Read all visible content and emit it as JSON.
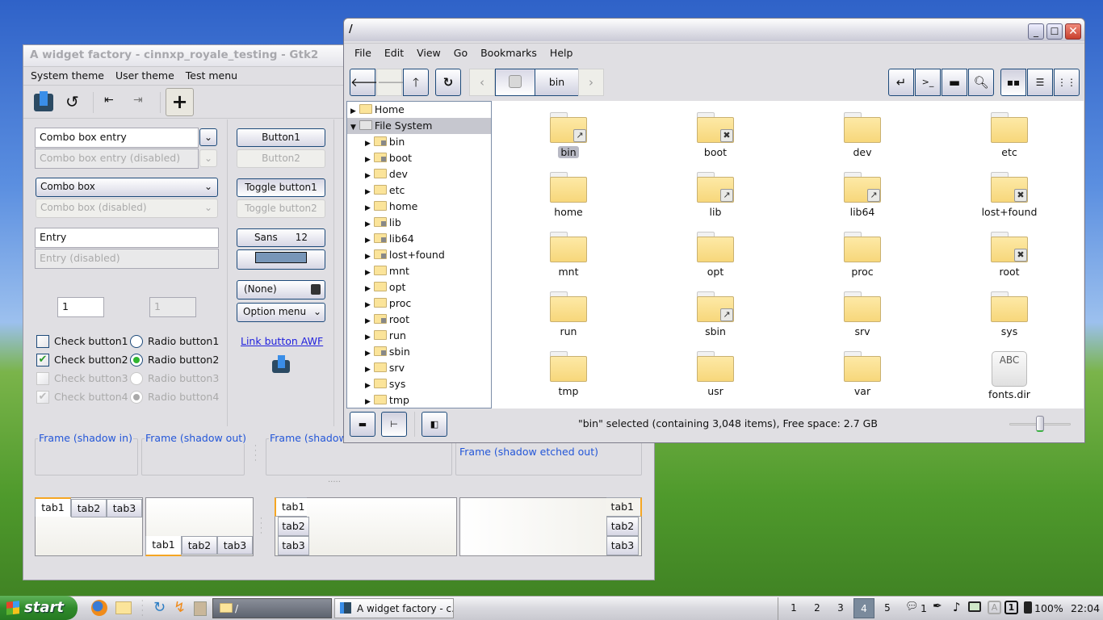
{
  "widget_factory": {
    "title": "A widget factory - cinnxp_royale_testing - Gtk2",
    "menu": [
      "System theme",
      "User theme",
      "Test menu"
    ],
    "toolbar_icons": [
      "awf-logo-icon",
      "refresh-icon",
      "previous-icon",
      "next-icon",
      "add-icon"
    ],
    "combo_entry": "Combo box entry",
    "combo_entry_disabled": "Combo box entry (disabled)",
    "combo": "Combo box",
    "combo_disabled": "Combo box (disabled)",
    "entry": "Entry",
    "entry_disabled": "Entry (disabled)",
    "spin1": "1",
    "spin2": "1",
    "checks": [
      {
        "label": "Check button1",
        "checked": false
      },
      {
        "label": "Check button2",
        "checked": true
      },
      {
        "label": "Check button3",
        "checked": false
      },
      {
        "label": "Check button4",
        "checked": true
      }
    ],
    "radios": [
      {
        "label": "Radio button1",
        "selected": false
      },
      {
        "label": "Radio button2",
        "selected": true
      },
      {
        "label": "Radio button3",
        "selected": false
      },
      {
        "label": "Radio button4",
        "selected": true
      }
    ],
    "button1": "Button1",
    "button2": "Button2",
    "toggle1": "Toggle button1",
    "toggle2": "Toggle button2",
    "font_name": "Sans",
    "font_size": "12",
    "color_value": "#7896b8",
    "file_chooser": "(None)",
    "option_menu": "Option menu",
    "link": "Link button AWF",
    "frames": [
      "Frame (shadow in)",
      "Frame (shadow out)",
      "Frame (shadow etched in)",
      "Frame (shadow etched out)"
    ],
    "tabs": [
      "tab1",
      "tab2",
      "tab3"
    ]
  },
  "file_manager": {
    "title": "/",
    "menu": [
      "File",
      "Edit",
      "View",
      "Go",
      "Bookmarks",
      "Help"
    ],
    "path_current": "bin",
    "tree": [
      {
        "label": "Home",
        "expanded": false
      },
      {
        "label": "File System",
        "expanded": true,
        "selected": true
      }
    ],
    "tree_children": [
      {
        "n": "bin",
        "e": "link"
      },
      {
        "n": "boot",
        "e": "x"
      },
      {
        "n": "dev"
      },
      {
        "n": "etc"
      },
      {
        "n": "home"
      },
      {
        "n": "lib",
        "e": "link"
      },
      {
        "n": "lib64",
        "e": "link"
      },
      {
        "n": "lost+found",
        "e": "x"
      },
      {
        "n": "mnt"
      },
      {
        "n": "opt"
      },
      {
        "n": "proc"
      },
      {
        "n": "root",
        "e": "x"
      },
      {
        "n": "run"
      },
      {
        "n": "sbin",
        "e": "link"
      },
      {
        "n": "srv"
      },
      {
        "n": "sys"
      },
      {
        "n": "tmp"
      }
    ],
    "files": [
      {
        "n": "bin",
        "e": "link",
        "selected": true
      },
      {
        "n": "boot",
        "e": "x"
      },
      {
        "n": "dev"
      },
      {
        "n": "etc"
      },
      {
        "n": "home"
      },
      {
        "n": "lib",
        "e": "link"
      },
      {
        "n": "lib64",
        "e": "link"
      },
      {
        "n": "lost+found",
        "e": "x"
      },
      {
        "n": "mnt"
      },
      {
        "n": "opt"
      },
      {
        "n": "proc"
      },
      {
        "n": "root",
        "e": "x"
      },
      {
        "n": "run"
      },
      {
        "n": "sbin",
        "e": "link"
      },
      {
        "n": "srv"
      },
      {
        "n": "sys"
      },
      {
        "n": "tmp"
      },
      {
        "n": "usr"
      },
      {
        "n": "var"
      },
      {
        "n": "fonts.dir",
        "type": "text",
        "thumb": "ABC"
      }
    ],
    "status": "\"bin\" selected (containing 3,048 items), Free space: 2.7 GB",
    "zoom_level_percent": 50
  },
  "taskbar": {
    "start": "start",
    "tasks": [
      "/",
      "A widget factory - c..."
    ],
    "workspaces": [
      "1",
      "2",
      "3",
      "4",
      "5"
    ],
    "active_workspace": "4",
    "notifications": "1",
    "battery": "100%",
    "clock": "22:04"
  }
}
